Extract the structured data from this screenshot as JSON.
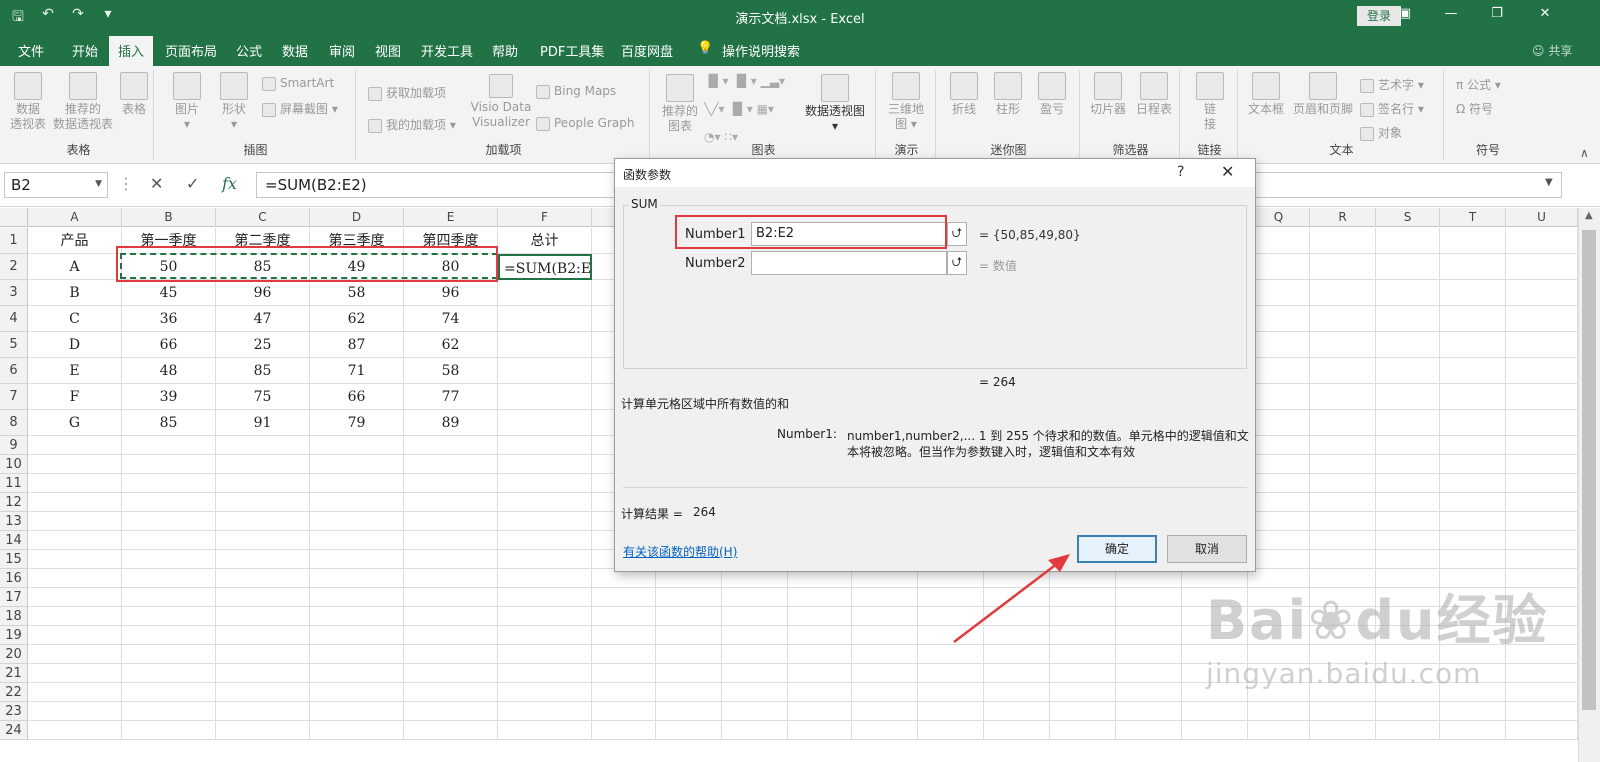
{
  "window": {
    "title": "演示文档.xlsx  -  Excel",
    "login_label": "登录",
    "qat_icons": [
      "save-icon",
      "undo-icon",
      "redo-icon",
      "customize-icon"
    ],
    "accent_color": "#217346"
  },
  "tabs": [
    "文件",
    "开始",
    "插入",
    "页面布局",
    "公式",
    "数据",
    "审阅",
    "视图",
    "开发工具",
    "帮助",
    "PDF工具集",
    "百度网盘",
    "操作说明搜索"
  ],
  "active_tab": "插入",
  "share_label": "共享",
  "ribbon": {
    "groups": {
      "tables": {
        "label": "表格",
        "items": [
          "数据\n透视表",
          "推荐的\n数据透视表",
          "表格"
        ]
      },
      "illustrations": {
        "label": "插图",
        "items": [
          "图片",
          "形状",
          "SmartArt",
          "屏幕截图"
        ]
      },
      "addins": {
        "label": "加载项",
        "items": [
          "获取加载项",
          "我的加载项",
          "Visio Data\nVisualizer",
          "Bing Maps",
          "People Graph"
        ]
      },
      "charts": {
        "label": "图表",
        "items": [
          "推荐的\n图表",
          "数据透视图"
        ]
      },
      "tours": {
        "label": "演示",
        "items": [
          "三维地\n图"
        ]
      },
      "sparklines": {
        "label": "迷你图",
        "items": [
          "折线",
          "柱形",
          "盈亏"
        ]
      },
      "filters": {
        "label": "筛选器",
        "items": [
          "切片器",
          "日程表"
        ]
      },
      "links": {
        "label": "链接",
        "items": [
          "链\n接"
        ]
      },
      "text": {
        "label": "文本",
        "items": [
          "文本框",
          "页眉和页脚",
          "艺术字",
          "签名行",
          "对象"
        ]
      },
      "symbols": {
        "label": "符号",
        "items": [
          "公式",
          "符号"
        ]
      }
    }
  },
  "formula_bar": {
    "name_box": "B2",
    "formula": "=SUM(B2:E2)",
    "fx": "fx"
  },
  "sheet": {
    "columns": [
      "A",
      "B",
      "C",
      "D",
      "E",
      "F",
      "Q",
      "R",
      "S",
      "T",
      "U"
    ],
    "rows": [
      "1",
      "2",
      "3",
      "4",
      "5",
      "6",
      "7",
      "8",
      "9",
      "10",
      "11",
      "12",
      "13",
      "14",
      "15",
      "16",
      "17",
      "18",
      "19",
      "20",
      "21",
      "22",
      "23",
      "24"
    ],
    "header_row": [
      "产品",
      "第一季度",
      "第二季度",
      "第三季度",
      "第四季度",
      "总计"
    ],
    "data": [
      [
        "A",
        "50",
        "85",
        "49",
        "80",
        "=SUM(B2:E2)"
      ],
      [
        "B",
        "45",
        "96",
        "58",
        "96",
        ""
      ],
      [
        "C",
        "36",
        "47",
        "62",
        "74",
        ""
      ],
      [
        "D",
        "66",
        "25",
        "87",
        "62",
        ""
      ],
      [
        "E",
        "48",
        "85",
        "71",
        "58",
        ""
      ],
      [
        "F",
        "39",
        "75",
        "66",
        "77",
        ""
      ],
      [
        "G",
        "85",
        "91",
        "79",
        "89",
        ""
      ]
    ]
  },
  "dialog": {
    "title": "函数参数",
    "help_q": "?",
    "close": "✕",
    "function_name": "SUM",
    "args": [
      {
        "label": "Number1",
        "value": "B2:E2",
        "result": "=  {50,85,49,80}"
      },
      {
        "label": "Number2",
        "value": "",
        "result": "=  数值"
      }
    ],
    "total_result": "=   264",
    "description": "计算单元格区域中所有数值的和",
    "arg_help_label": "Number1:",
    "arg_help_text_1": "number1,number2,... 1 到 255 个待求和的数值。单元格中的逻辑值和文",
    "arg_help_text_2": "本将被忽略。但当作为参数键入时，逻辑值和文本有效",
    "calc_result_label": "计算结果 =",
    "calc_result_value": "264",
    "help_link": "有关该函数的帮助(H)",
    "ok": "确定",
    "cancel": "取消"
  },
  "watermark": {
    "brand": "Bai",
    "brand_mid": "du",
    "brand_cn": "经验",
    "url": "jingyan.baidu.com"
  }
}
